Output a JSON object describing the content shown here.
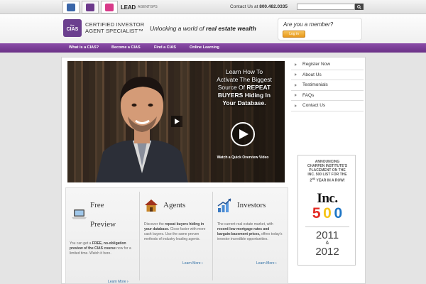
{
  "topbar": {
    "lead_label": "LEAD",
    "agentgps_label": "AGENTGPS",
    "contact_prefix": "Contact Us at",
    "contact_phone": "800.482.0335",
    "search_placeholder": ""
  },
  "header": {
    "logo_small": "the",
    "logo_big": "CIAS",
    "brand_line1": "Certified Investor",
    "brand_line2": "Agent Specialist™",
    "tagline_prefix": "Unlocking a world of",
    "tagline_bold": "real estate wealth",
    "member_question": "Are you a member?",
    "login_label": "Log in"
  },
  "nav": {
    "items": [
      {
        "label": "What is a CIAS?"
      },
      {
        "label": "Become a CIAS"
      },
      {
        "label": "Find a CIAS"
      },
      {
        "label": "Online Learning"
      }
    ]
  },
  "hero": {
    "line1": "Learn How To",
    "line2": "Activate The Biggest",
    "line3_prefix": "Source Of",
    "line3_bold": "REPEAT",
    "line4_bold": "BUYERS Hiding In",
    "line5_bold": "Your Database.",
    "watch_label": "Watch a Quick Overview Video"
  },
  "sidebar": {
    "items": [
      {
        "label": "Register Now"
      },
      {
        "label": "About Us"
      },
      {
        "label": "Testimonials"
      },
      {
        "label": "FAQs"
      },
      {
        "label": "Contact Us"
      }
    ]
  },
  "award": {
    "line1": "Announcing",
    "line2": "Charfen Institute's",
    "line3": "placement on the",
    "line4": "Inc. 500 list for the",
    "line5_num": "2",
    "line5_sup": "ND",
    "line5_rest": "year in a row!",
    "inc_label": "Inc.",
    "digits": [
      "5",
      "0",
      "0"
    ],
    "year1": "2011",
    "amp": "&",
    "year2": "2012"
  },
  "features": [
    {
      "title_line1": "Free",
      "title_line2": "Preview",
      "body_prefix": "You can get a",
      "body_bold1": "FREE, no-obligation preview of the CIAS course",
      "body_rest": "now for a limited time. Watch it here.",
      "learn_label": "Learn More"
    },
    {
      "title": "Agents",
      "body_prefix": "Discover the",
      "body_bold": "repeat buyers hiding in your database.",
      "body_rest": "Close faster with more cash buyers. Use the same proven methods of industry leading agents.",
      "learn_label": "Learn More"
    },
    {
      "title": "Investors",
      "body_prefix": "The current real estate market, with",
      "body_bold": "record-low mortgage rates and bargain-basement prices,",
      "body_rest": "offers today's investor incredible opportunities.",
      "learn_label": "Learn More"
    }
  ],
  "colors": {
    "nav_purple": "#7a3f98",
    "login_orange": "#f0a52a",
    "link_blue": "#2f6fa5"
  }
}
